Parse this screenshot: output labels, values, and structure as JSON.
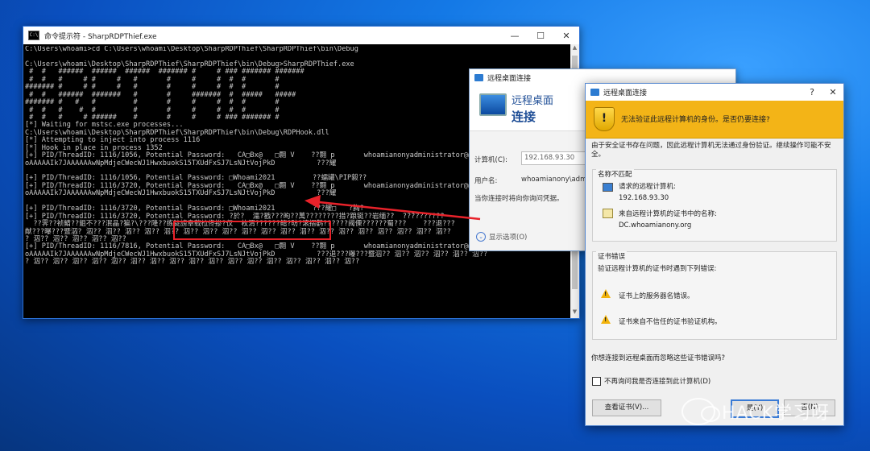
{
  "cmd": {
    "title": "命令提示符 - SharpRDPThief.exe",
    "icon": "terminal-icon",
    "lines": [
      "C:\\Users\\whoami>cd C:\\Users\\whoami\\Desktop\\SharpRDPThief\\SharpRDPThief\\bin\\Debug",
      "",
      "C:\\Users\\whoami\\Desktop\\SharpRDPThief\\SharpRDPThief\\bin\\Debug>SharpRDPThief.exe",
      " #  #   ######  ######  ######  ####### #     # ### ####### #######",
      " #  #   #     # #     #   #       #     #     #  #  #       #",
      "####### #     # #     #   #       #     #     #  #  #       #",
      " #  #   ######  #######   #       #     #######  #  #####   #####",
      "####### #   #   #         #       #     #     #  #  #       #",
      " #  #   #    #  #         #       #     #     #  #  #       #",
      " #  #   #     # ######    #       #     #     # ### ####### #",
      "[*] Waiting for mstsc.exe processes...",
      "C:\\Users\\whoami\\Desktop\\SharpRDPThief\\SharpRDPThief\\bin\\Debug\\RDPHook.dll",
      "[*] Attempting to inject into process 1116",
      "[*] Hook in place in process 1352",
      "[+] PID/ThreadID: 1116/1056, Potential Password:   CA□Bx@   □翾 V    ??翾 p       whoamianonyadministrator@@",
      "oAAAAAIk7JAAAAAAwNpMdjeCWecWJ1HwxbuokS15TXUdFxSJ7LsNJtVojPkD          ???耀",
      "",
      "[+] PID/ThreadID: 1116/1056, Potential Password: □Whoami2021         ??蠕罐\\PIP毅??",
      "[+] PID/ThreadID: 1116/3720, Potential Password:   CA□Bx@   □翾 V    ??翾 p       whoamianonyadministrator@@",
      "oAAAAAIk7JAAAAAAwNpMdjeCWecWJ1HwxbuokS15TXUdFxSJ7LsNJtVojPkD          ???耀",
      "",
      "[+] PID/ThreadID: 1116/3720, Potential Password: □Whoami2021         ???耀□   ?胸?",
      "[+] PID/ThreadID: 1116/3720, Potential Password: ?於?  濡?戳???昫??萬????????措?踉铤??岩缅??  ??????????",
      "  ??霁??祯鲭??鉏不???泯晶?猵?\\???隆??练锭謗阜戟柆佟掺?仅  枚渭??????鳍?昉?滚摺鹳??????阈傈??????蜀???    ???退???",
      "猷???曝???暨泅? 泅?? 泅?? 泅?? 泅?? 泅?? 泅?? 泅?? 泅?? 泅?? 泅?? 泅?? 泅?? 泅?? 泅?? 泅?? 泅?? 泅?? 泅?? 泅??",
      "? 泅?? 泅?? 泅?? 泅?? 泅??",
      "[+] PID/ThreadID: 1116/7816, Potential Password:   CA□Bx@   □翾 V    ??翾 p       whoamianonyadministrator@@",
      "oAAAAAIk7JAAAAAAwNpMdjeCWecWJ1HwxbuokS15TXUdFxSJ7LsNJtVojPkD          ???退???曝???暨泅?? 泅?? 泅?? 泅?? 泅?? 泅??",
      "? 泅?? 泅?? 泅?? 泅?? 泅?? 泅?? 泅?? 泅?? 泅?? 泅?? 泅?? 泅?? 泅?? 泅?? 泅?? 泅?? 泅??"
    ]
  },
  "rdp_main": {
    "title": "远程桌面连接",
    "heading_line1": "远程桌面",
    "heading_line2": "连接",
    "computer_label": "计算机(C):",
    "computer_value": "192.168.93.30",
    "username_label": "用户名:",
    "username_value": "whoamianony\\admi",
    "prompt_note": "当你连接时将向你询问凭据。",
    "options_label": "显示选项(O)"
  },
  "cert_dialog": {
    "title": "远程桌面连接",
    "help_label": "?",
    "close_label": "✕",
    "banner_message": "无法验证此远程计算机的身份。是否仍要连接?",
    "description": "由于安全证书存在问题，因此远程计算机无法通过身份验证。继续操作可能不安全。",
    "name_mismatch": {
      "group_title": "名称不匹配",
      "requested_label": "请求的远程计算机:",
      "requested_value": "192.168.93.30",
      "cert_name_label": "来自远程计算机的证书中的名称:",
      "cert_name_value": "DC.whoamianony.org"
    },
    "cert_errors": {
      "group_title": "证书错误",
      "intro": "验证远程计算机的证书时遇到下列错误:",
      "errors": [
        "证书上的服务器名错误。",
        "证书来自不信任的证书验证机构。"
      ]
    },
    "question": "你想连接到远程桌面而忽略这些证书错误吗?",
    "dont_ask_label": "不再询问我是否连接到此计算机(D)",
    "view_cert_button": "查看证书(V)...",
    "yes_button": "是(Y)",
    "no_button": "否(N)"
  },
  "watermark": {
    "text": "HACK学习呀",
    "icon": "wechat-logo-icon"
  },
  "colors": {
    "highlight_box": "#e8222a",
    "banner": "#f3b417",
    "desktop": "#0a4fbf"
  }
}
